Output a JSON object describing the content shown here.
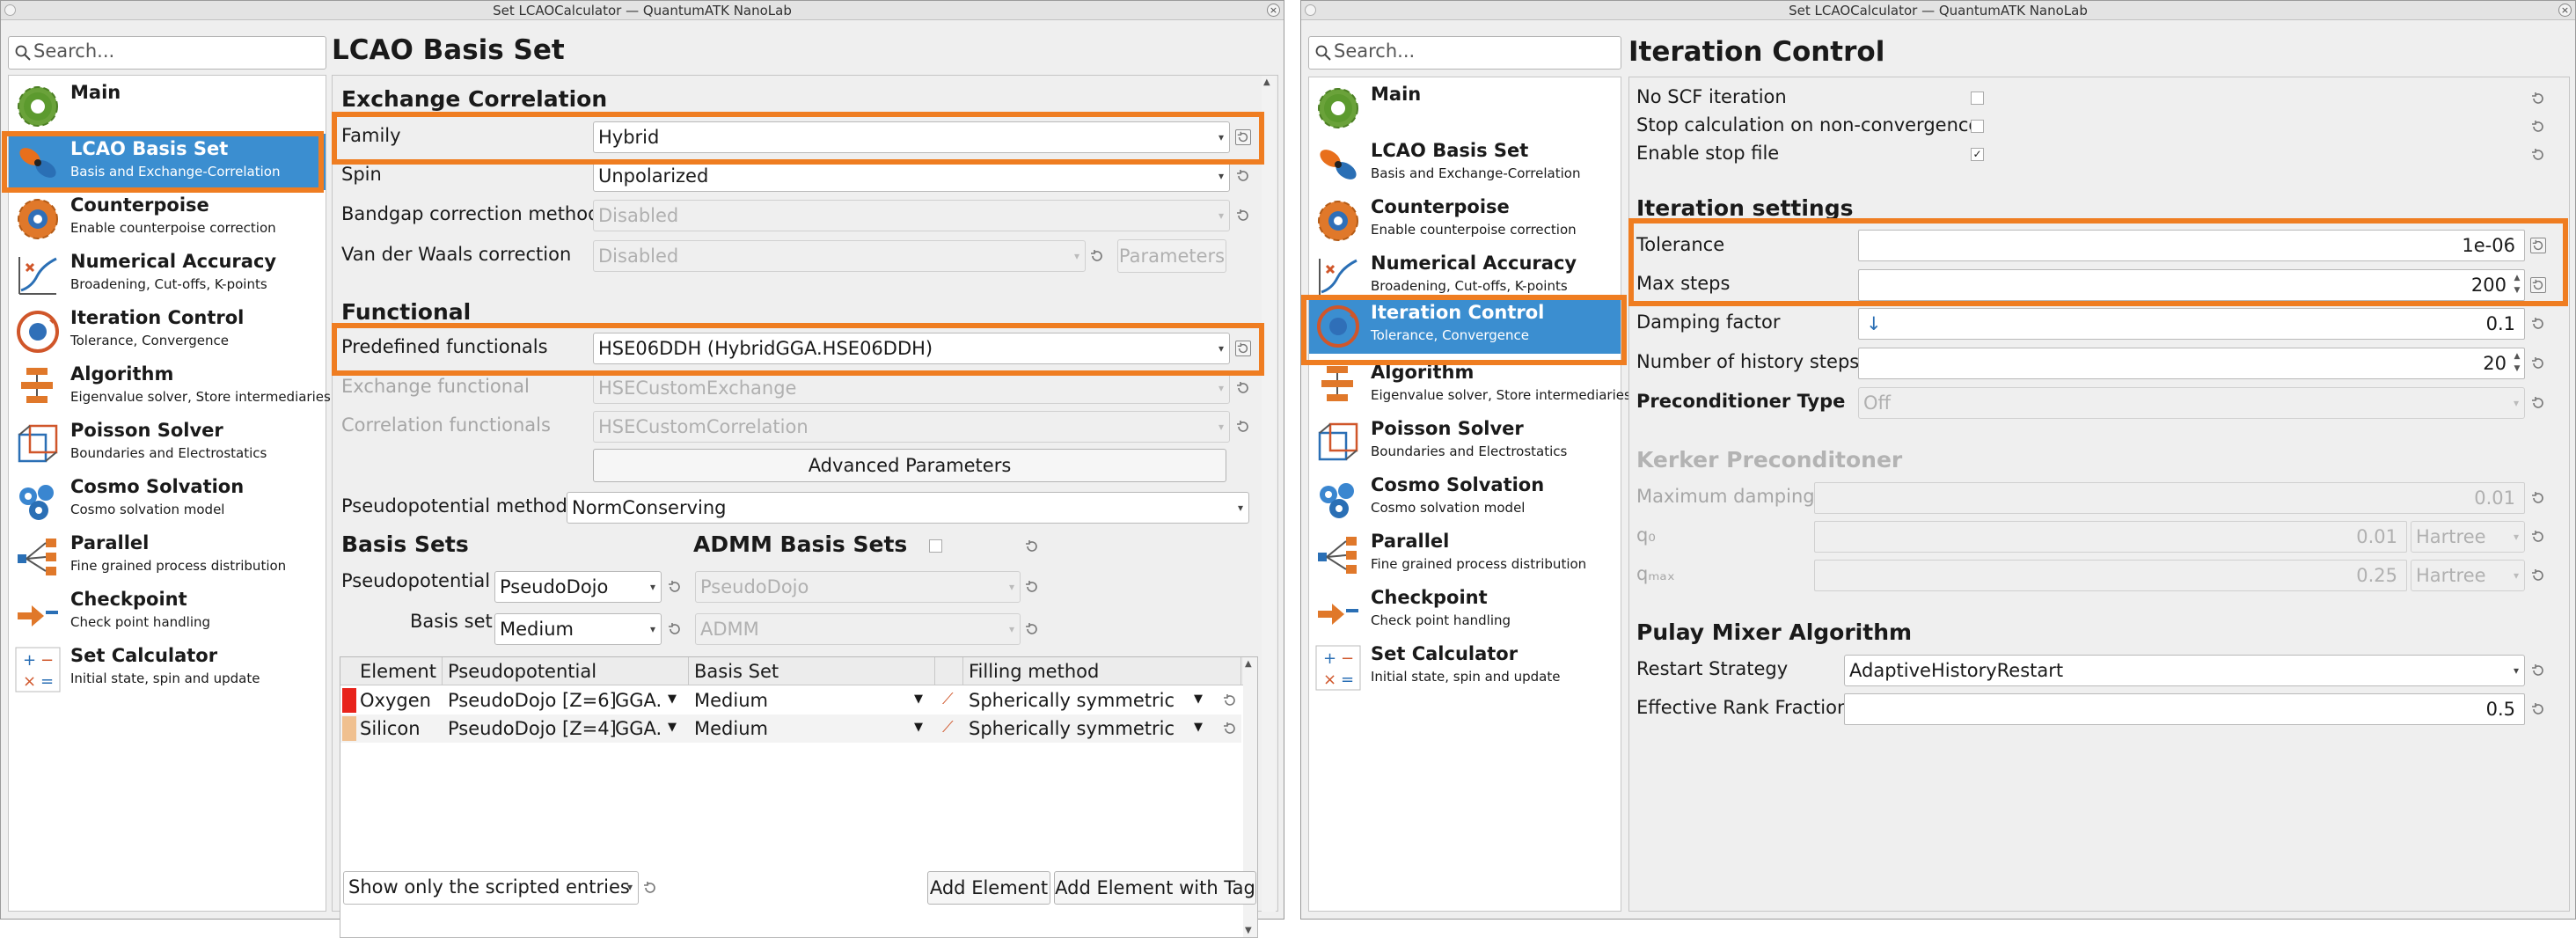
{
  "left_window": {
    "title": "Set LCAOCalculator — QuantumATK NanoLab",
    "search_placeholder": "Search...",
    "nav": [
      {
        "title": "Main",
        "subtitle": ""
      },
      {
        "title": "LCAO Basis Set",
        "subtitle": "Basis and Exchange-Correlation"
      },
      {
        "title": "Counterpoise",
        "subtitle": "Enable counterpoise correction"
      },
      {
        "title": "Numerical Accuracy",
        "subtitle": "Broadening, Cut-offs, K-points"
      },
      {
        "title": "Iteration Control",
        "subtitle": "Tolerance, Convergence"
      },
      {
        "title": "Algorithm",
        "subtitle": "Eigenvalue solver, Store intermediaries"
      },
      {
        "title": "Poisson Solver",
        "subtitle": "Boundaries and Electrostatics"
      },
      {
        "title": "Cosmo Solvation",
        "subtitle": "Cosmo solvation model"
      },
      {
        "title": "Parallel",
        "subtitle": "Fine grained process distribution"
      },
      {
        "title": "Checkpoint",
        "subtitle": "Check point handling"
      },
      {
        "title": "Set Calculator",
        "subtitle": "Initial state, spin  and update"
      }
    ],
    "panel_title": "LCAO Basis Set",
    "exchange": {
      "heading": "Exchange Correlation",
      "family_label": "Family",
      "family_value": "Hybrid",
      "spin_label": "Spin",
      "spin_value": "Unpolarized",
      "bandgap_label": "Bandgap correction method",
      "bandgap_value": "Disabled",
      "vdw_label": "Van der Waals correction",
      "vdw_value": "Disabled",
      "parameters_button": "Parameters"
    },
    "functional": {
      "heading": "Functional",
      "predefined_label": "Predefined functionals",
      "predefined_value": "HSE06DDH (HybridGGA.HSE06DDH)",
      "exchange_label": "Exchange functional",
      "exchange_value": "HSECustomExchange",
      "correlation_label": "Correlation functionals",
      "correlation_value": "HSECustomCorrelation",
      "advanced_button": "Advanced Parameters",
      "pseudo_method_label": "Pseudopotential method",
      "pseudo_method_value": "NormConserving"
    },
    "basis": {
      "heading": "Basis Sets",
      "admm_heading": "ADMM Basis Sets",
      "pseudo_label": "Pseudopotential",
      "pseudo_value": "PseudoDojo",
      "basisset_label": "Basis set",
      "basisset_value": "Medium",
      "admm_pseudo_value": "PseudoDojo",
      "admm_basis_value": "ADMM"
    },
    "table": {
      "headers": [
        "Element",
        "Pseudopotential",
        "Basis Set",
        "Filling method"
      ],
      "rows": [
        {
          "element": "Oxygen",
          "color": "#e8231b",
          "pseudo": "PseudoDojo [Z=6]",
          "gga": "GGA.",
          "basis": "Medium",
          "filling": "Spherically symmetric"
        },
        {
          "element": "Silicon",
          "color": "#f0c08f",
          "pseudo": "PseudoDojo [Z=4]",
          "gga": "GGA.",
          "basis": "Medium",
          "filling": "Spherically symmetric"
        }
      ]
    },
    "footer": {
      "show_scripted": "Show only the scripted entries",
      "add_element": "Add Element",
      "add_element_tag": "Add Element with Tag"
    }
  },
  "right_window": {
    "title": "Set LCAOCalculator — QuantumATK NanoLab",
    "search_placeholder": "Search...",
    "nav": [
      {
        "title": "Main",
        "subtitle": ""
      },
      {
        "title": "LCAO Basis Set",
        "subtitle": "Basis and Exchange-Correlation"
      },
      {
        "title": "Counterpoise",
        "subtitle": "Enable counterpoise correction"
      },
      {
        "title": "Numerical Accuracy",
        "subtitle": "Broadening, Cut-offs, K-points"
      },
      {
        "title": "Iteration Control",
        "subtitle": "Tolerance, Convergence"
      },
      {
        "title": "Algorithm",
        "subtitle": "Eigenvalue solver, Store intermediaries"
      },
      {
        "title": "Poisson Solver",
        "subtitle": "Boundaries and Electrostatics"
      },
      {
        "title": "Cosmo Solvation",
        "subtitle": "Cosmo solvation model"
      },
      {
        "title": "Parallel",
        "subtitle": "Fine grained process distribution"
      },
      {
        "title": "Checkpoint",
        "subtitle": "Check point handling"
      },
      {
        "title": "Set Calculator",
        "subtitle": "Initial state, spin  and update"
      }
    ],
    "panel_title": "Iteration Control",
    "checks": [
      {
        "label": "No SCF iteration",
        "checked": false
      },
      {
        "label": "Stop calculation on non-convergence",
        "checked": false
      },
      {
        "label": "Enable stop file",
        "checked": true
      }
    ],
    "iteration": {
      "heading": "Iteration settings",
      "tolerance_label": "Tolerance",
      "tolerance_value": "1e-06",
      "maxsteps_label": "Max steps",
      "maxsteps_value": "200",
      "damping_label": "Damping factor",
      "damping_value": "0.1",
      "history_label": "Number of history steps",
      "history_value": "20",
      "precond_label": "Preconditioner Type",
      "precond_value": "Off"
    },
    "kerker": {
      "heading": "Kerker Preconditoner",
      "maxdamp_label": "Maximum damping",
      "maxdamp_value": "0.01",
      "q0_label": "q₀",
      "q0_value": "0.01",
      "q0_unit": "Hartree",
      "qmax_label": "qₘₐₓ",
      "qmax_value": "0.25",
      "qmax_unit": "Hartree"
    },
    "pulay": {
      "heading": "Pulay Mixer Algorithm",
      "restart_label": "Restart Strategy",
      "restart_value": "AdaptiveHistoryRestart",
      "rank_label": "Effective Rank Fraction",
      "rank_value": "0.5"
    }
  },
  "colors": {
    "accent": "#3b8ed0",
    "highlight": "#ef7d21"
  }
}
